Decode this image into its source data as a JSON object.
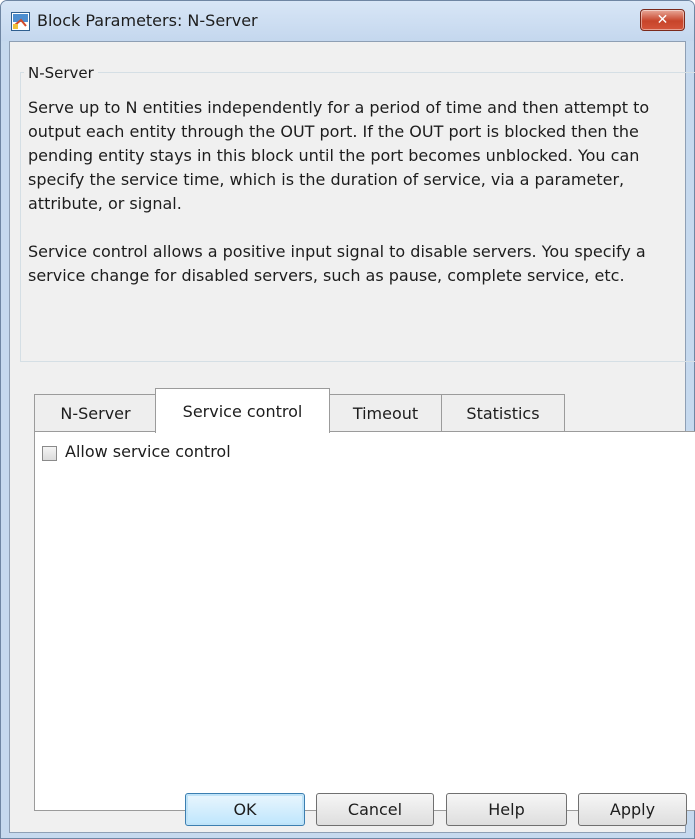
{
  "window": {
    "title": "Block Parameters: N-Server",
    "close_symbol": "✕"
  },
  "group": {
    "legend": "N-Server",
    "description": [
      "Serve up to N entities independently for a period of time and then attempt to output each entity through the OUT port. If the OUT port is blocked then the pending entity stays in this block until the port becomes unblocked. You can specify the service time, which is the duration of service, via a parameter, attribute, or signal.",
      "Service control allows a positive input signal to disable servers. You specify a service change for disabled servers, such as pause, complete service, etc."
    ]
  },
  "tabs": [
    {
      "label": "N-Server",
      "active": false
    },
    {
      "label": "Service control",
      "active": true
    },
    {
      "label": "Timeout",
      "active": false
    },
    {
      "label": "Statistics",
      "active": false
    }
  ],
  "service_control": {
    "checkbox_label": "Allow service control",
    "checked": false
  },
  "buttons": {
    "ok": "OK",
    "cancel": "Cancel",
    "help": "Help",
    "apply": "Apply"
  },
  "colors": {
    "title_bar": "#c6d9ee",
    "close_button": "#c7442a",
    "dialog_background": "#f0f0f0",
    "default_button_border": "#3c7fb1"
  },
  "icons": {
    "app": "simulink-block-icon",
    "close": "close-icon"
  }
}
